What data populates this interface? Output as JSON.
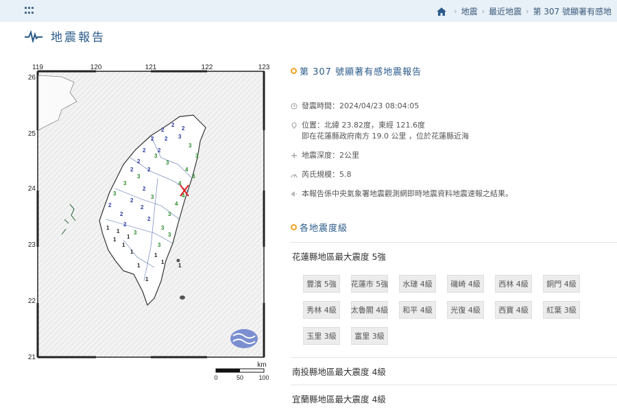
{
  "nav": {
    "breadcrumb": [
      "地震",
      "最近地震",
      "第 307 號顯著有感地"
    ]
  },
  "page": {
    "title": "地震報告"
  },
  "map": {
    "lon_ticks": [
      "119",
      "120",
      "121",
      "122",
      "123"
    ],
    "lat_ticks": [
      "26",
      "25",
      "24",
      "23",
      "22",
      "21"
    ],
    "scale_unit": "km",
    "scale_labels": [
      "0",
      "50",
      "100"
    ],
    "epicenter_color": "#e02020"
  },
  "report": {
    "title": "第 307 號顯著有感地震報告",
    "time": "發震時間：2024/04/23 08:04:05",
    "location": "位置：北緯 23.82度，東經 121.6度",
    "location_sub": "即在花蓮縣政府南方 19.0 公里 ，位於花蓮縣近海",
    "depth": "地震深度：2公里",
    "magnitude": "芮氏規模：5.8",
    "note": "本報告係中央氣象署地震觀測網即時地震資料地震速報之結果。"
  },
  "levels": {
    "title": "各地震度級",
    "counties": [
      {
        "label": "花蓮縣地區最大震度 5強",
        "stations": [
          "豐濱 5強",
          "花蓮市 5強",
          "水璉 4級",
          "磯崎 4級",
          "西林 4級",
          "銅門 4級",
          "秀林 4級",
          "太魯閣 4級",
          "和平 4級",
          "光復 4級",
          "西寶 4級",
          "紅葉 3級",
          "玉里 3級",
          "富里 3級"
        ]
      },
      {
        "label": "南投縣地區最大震度 4級"
      },
      {
        "label": "宜蘭縣地區最大震度 4級"
      }
    ]
  },
  "colors": {
    "accent": "#2a5a8a",
    "dot": "#f0a020",
    "topbar": "#e8f0f8"
  }
}
